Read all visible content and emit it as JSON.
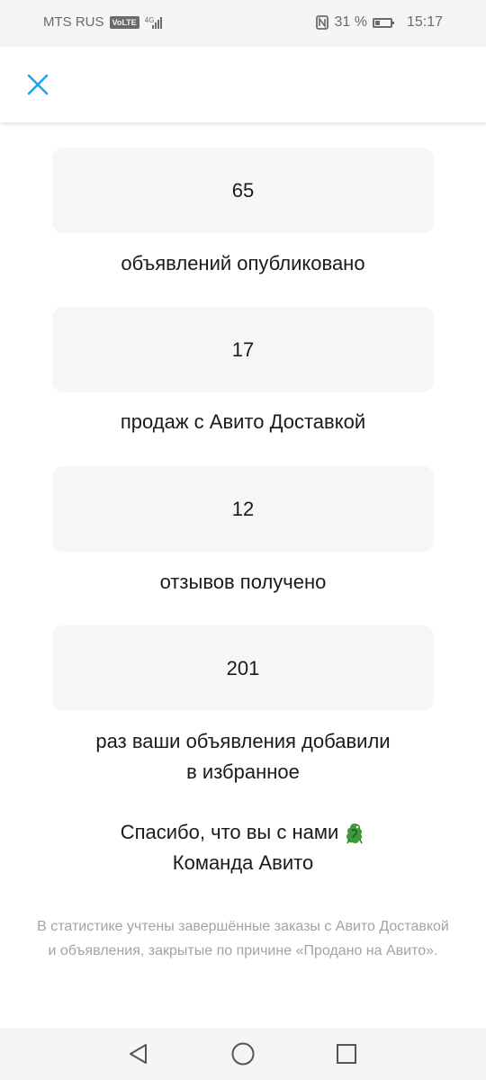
{
  "status_bar": {
    "carrier": "MTS RUS",
    "volte": "VoLTE",
    "network": "4G",
    "battery_text": "31 %",
    "battery_level": 0.31,
    "time": "15:17"
  },
  "header": {
    "close_icon": "close-icon",
    "accent_color": "#1fa3e8"
  },
  "stats": [
    {
      "value": "65",
      "label_lines": [
        "объявлений опубликовано"
      ]
    },
    {
      "value": "17",
      "label_lines": [
        "продаж с Авито Доставкой"
      ]
    },
    {
      "value": "12",
      "label_lines": [
        "отзывов получено"
      ]
    },
    {
      "value": "201",
      "label_lines": [
        "раз ваши объявления добавили",
        "в избранное"
      ]
    }
  ],
  "thanks": {
    "line1": "Спасибо, что вы с нами",
    "line2": "Команда Авито",
    "emoji_icon": "dragon-icon"
  },
  "footnote": "В статистике учтены завершённые заказы с Авито Доставкой и объявления, закрытые по причине «Продано на Авито».",
  "nav_bar": {
    "back_icon": "back-triangle-icon",
    "home_icon": "home-circle-icon",
    "recents_icon": "recents-square-icon"
  }
}
